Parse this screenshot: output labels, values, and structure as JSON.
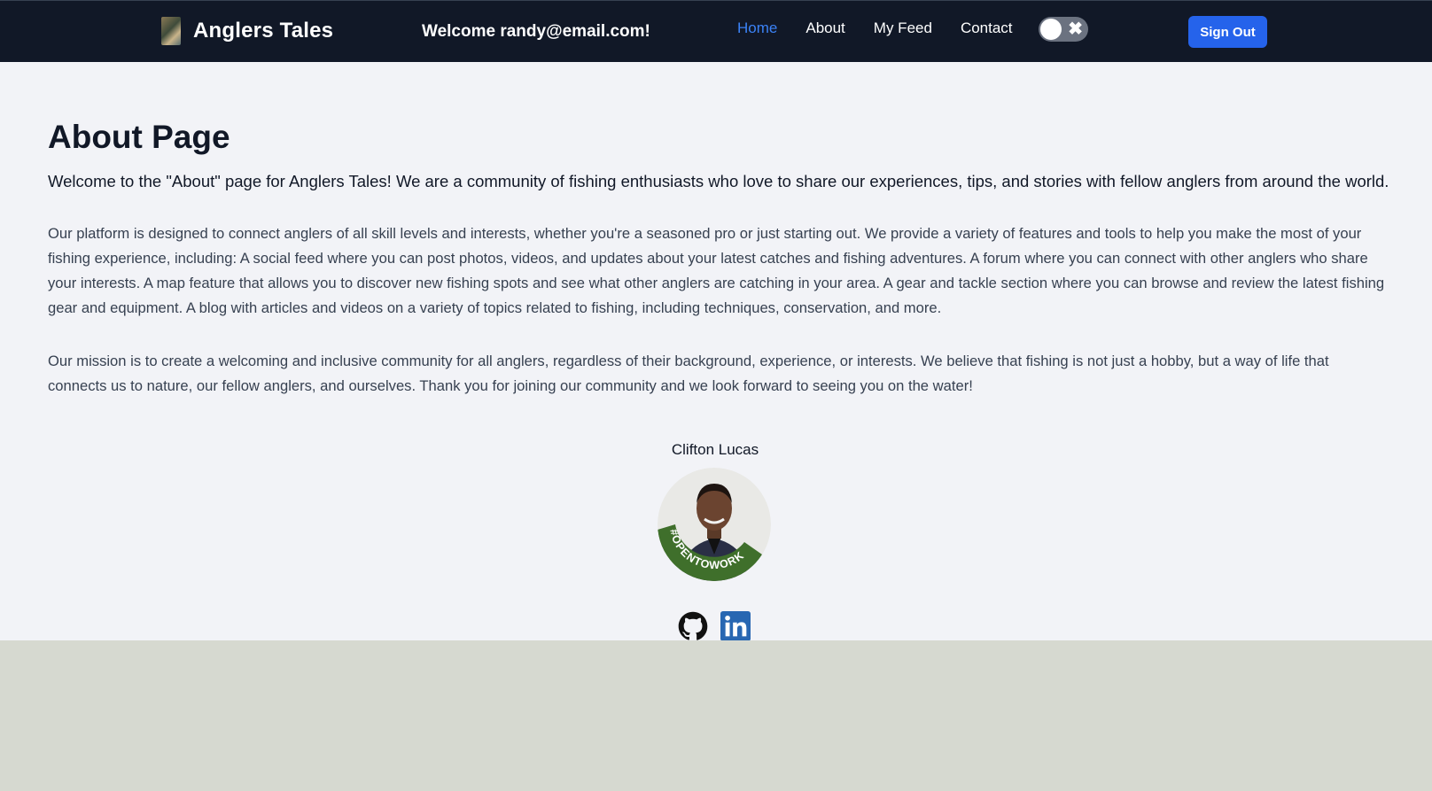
{
  "navbar": {
    "brand": "Anglers Tales",
    "welcome": "Welcome randy@email.com!",
    "links": [
      {
        "label": "Home",
        "active": true
      },
      {
        "label": "About",
        "active": false
      },
      {
        "label": "My Feed",
        "active": false
      },
      {
        "label": "Contact",
        "active": false
      }
    ],
    "theme_toggle": {
      "state": "off",
      "icon": "close-icon"
    },
    "signout_label": "Sign Out"
  },
  "about": {
    "title": "About Page",
    "intro": "Welcome to the \"About\" page for Anglers Tales! We are a community of fishing enthusiasts who love to share our experiences, tips, and stories with fellow anglers from around the world.",
    "paragraphs": [
      "Our platform is designed to connect anglers of all skill levels and interests, whether you're a seasoned pro or just starting out. We provide a variety of features and tools to help you make the most of your fishing experience, including: A social feed where you can post photos, videos, and updates about your latest catches and fishing adventures. A forum where you can connect with other anglers who share your interests. A map feature that allows you to discover new fishing spots and see what other anglers are catching in your area. A gear and tackle section where you can browse and review the latest fishing gear and equipment. A blog with articles and videos on a variety of topics related to fishing, including techniques, conservation, and more.",
      "Our mission is to create a welcoming and inclusive community for all anglers, regardless of their background, experience, or interests. We believe that fishing is not just a hobby, but a way of life that connects us to nature, our fellow anglers, and ourselves. Thank you for joining our community and we look forward to seeing you on the water!"
    ]
  },
  "team": {
    "member_name": "Clifton Lucas",
    "avatar_badge": "#OPENTOWORK",
    "socials": [
      {
        "icon": "github-icon"
      },
      {
        "icon": "linkedin-icon",
        "color": "#2867b2"
      }
    ]
  },
  "colors": {
    "nav_bg": "#111827",
    "accent": "#2563eb",
    "active_link": "#3b82f6",
    "page_bg": "#f2f3f7",
    "footer_bg": "#d6d9d0"
  }
}
